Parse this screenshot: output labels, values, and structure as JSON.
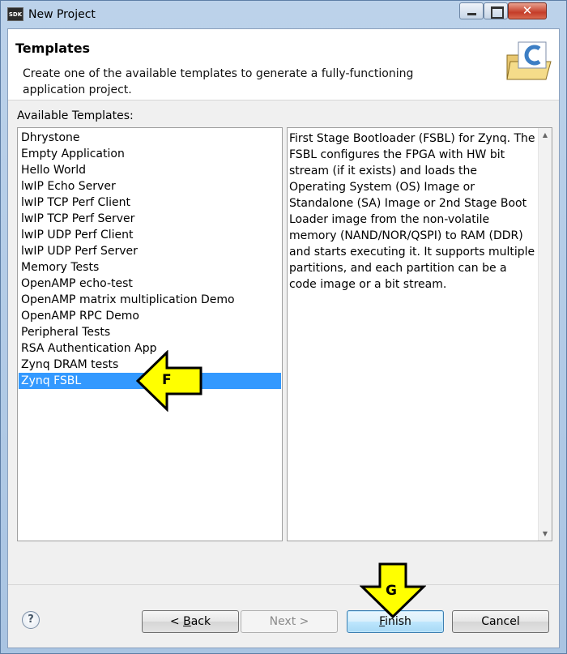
{
  "window": {
    "icon_text": "SDK",
    "title": "New Project"
  },
  "header": {
    "title": "Templates",
    "description": "Create one of the available templates to generate a fully-functioning application project."
  },
  "templates": {
    "label": "Available Templates:",
    "items": [
      "Dhrystone",
      "Empty Application",
      "Hello World",
      "lwIP Echo Server",
      "lwIP TCP Perf Client",
      "lwIP TCP Perf Server",
      "lwIP UDP Perf Client",
      "lwIP UDP Perf Server",
      "Memory Tests",
      "OpenAMP echo-test",
      "OpenAMP matrix multiplication Demo",
      "OpenAMP RPC Demo",
      "Peripheral Tests",
      "RSA Authentication App",
      "Zynq DRAM tests",
      "Zynq FSBL"
    ],
    "selected": "Zynq FSBL"
  },
  "description": {
    "text": "First Stage Bootloader (FSBL) for Zynq. The FSBL configures the FPGA with HW bit stream (if it exists)  and loads the Operating System (OS) Image or Standalone (SA) Image or 2nd Stage Boot Loader image from the non-volatile memory (NAND/NOR/QSPI) to RAM (DDR) and starts executing it.  It supports multiple partitions,  and each partition can be a code image or a bit stream."
  },
  "buttons": {
    "help": "?",
    "back_prefix": "< ",
    "back_mnemonic": "B",
    "back_rest": "ack",
    "next": "Next >",
    "finish_mnemonic": "F",
    "finish_rest": "inish",
    "cancel": "Cancel"
  },
  "annotations": {
    "arrow_f_label": "F",
    "arrow_g_label": "G"
  },
  "colors": {
    "selection": "#3399ff",
    "annotation_arrow": "#ffff00"
  }
}
